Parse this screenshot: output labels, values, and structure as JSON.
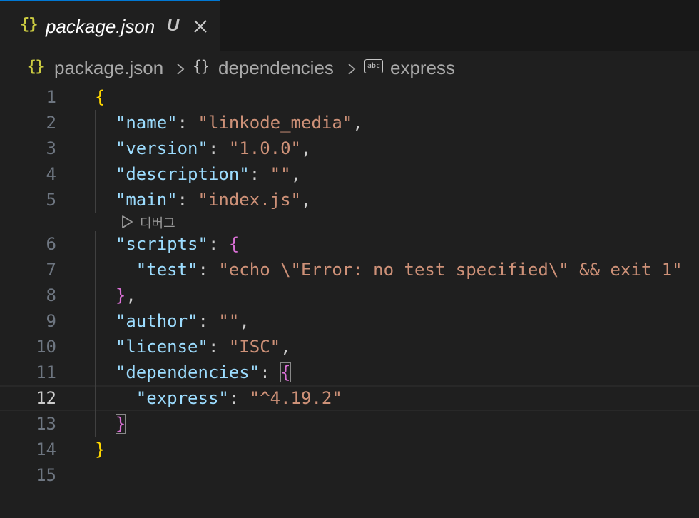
{
  "tab": {
    "file_icon": "{}",
    "title": "package.json",
    "status": "U"
  },
  "breadcrumb": {
    "file_icon": "{}",
    "file": "package.json",
    "object_icon": "{}",
    "object": "dependencies",
    "string_icon": "abc",
    "key": "express"
  },
  "codelens": {
    "label": "디버그"
  },
  "editor": {
    "current_line": 12,
    "lines": [
      {
        "n": "1",
        "code": [
          {
            "c": "b1",
            "t": "{"
          }
        ]
      },
      {
        "n": "2",
        "code": [
          {
            "c": "k",
            "t": "  \"name\""
          },
          {
            "c": "p",
            "t": ": "
          },
          {
            "c": "s",
            "t": "\"linkode_media\""
          },
          {
            "c": "p",
            "t": ","
          }
        ]
      },
      {
        "n": "3",
        "code": [
          {
            "c": "k",
            "t": "  \"version\""
          },
          {
            "c": "p",
            "t": ": "
          },
          {
            "c": "s",
            "t": "\"1.0.0\""
          },
          {
            "c": "p",
            "t": ","
          }
        ]
      },
      {
        "n": "4",
        "code": [
          {
            "c": "k",
            "t": "  \"description\""
          },
          {
            "c": "p",
            "t": ": "
          },
          {
            "c": "s",
            "t": "\"\""
          },
          {
            "c": "p",
            "t": ","
          }
        ]
      },
      {
        "n": "5",
        "code": [
          {
            "c": "k",
            "t": "  \"main\""
          },
          {
            "c": "p",
            "t": ": "
          },
          {
            "c": "s",
            "t": "\"index.js\""
          },
          {
            "c": "p",
            "t": ","
          }
        ]
      },
      {
        "n": "6",
        "code": [
          {
            "c": "k",
            "t": "  \"scripts\""
          },
          {
            "c": "p",
            "t": ": "
          },
          {
            "c": "b2",
            "t": "{"
          }
        ]
      },
      {
        "n": "7",
        "code": [
          {
            "c": "k",
            "t": "    \"test\""
          },
          {
            "c": "p",
            "t": ": "
          },
          {
            "c": "s",
            "t": "\"echo \\\"Error: no test specified\\\" && exit 1\""
          }
        ]
      },
      {
        "n": "8",
        "code": [
          {
            "c": "p",
            "t": "  "
          },
          {
            "c": "b2",
            "t": "}"
          },
          {
            "c": "p",
            "t": ","
          }
        ]
      },
      {
        "n": "9",
        "code": [
          {
            "c": "k",
            "t": "  \"author\""
          },
          {
            "c": "p",
            "t": ": "
          },
          {
            "c": "s",
            "t": "\"\""
          },
          {
            "c": "p",
            "t": ","
          }
        ]
      },
      {
        "n": "10",
        "code": [
          {
            "c": "k",
            "t": "  \"license\""
          },
          {
            "c": "p",
            "t": ": "
          },
          {
            "c": "s",
            "t": "\"ISC\""
          },
          {
            "c": "p",
            "t": ","
          }
        ]
      },
      {
        "n": "11",
        "code": [
          {
            "c": "k",
            "t": "  \"dependencies\""
          },
          {
            "c": "p",
            "t": ": "
          },
          {
            "c": "b2 bm",
            "t": "{"
          }
        ]
      },
      {
        "n": "12",
        "code": [
          {
            "c": "k",
            "t": "    \"express\""
          },
          {
            "c": "p",
            "t": ": "
          },
          {
            "c": "s",
            "t": "\"^4.19.2\""
          }
        ]
      },
      {
        "n": "13",
        "code": [
          {
            "c": "p",
            "t": "  "
          },
          {
            "c": "b2 bm",
            "t": "}"
          }
        ]
      },
      {
        "n": "14",
        "code": [
          {
            "c": "b1",
            "t": "}"
          }
        ]
      },
      {
        "n": "15",
        "code": []
      }
    ]
  },
  "colors": {
    "background": "#1f1f1f",
    "tab_accent": "#0078d4",
    "json_key": "#9cdcfe",
    "json_string": "#ce9178",
    "bracket_level1": "#ffd700",
    "bracket_level2": "#da70d6"
  }
}
